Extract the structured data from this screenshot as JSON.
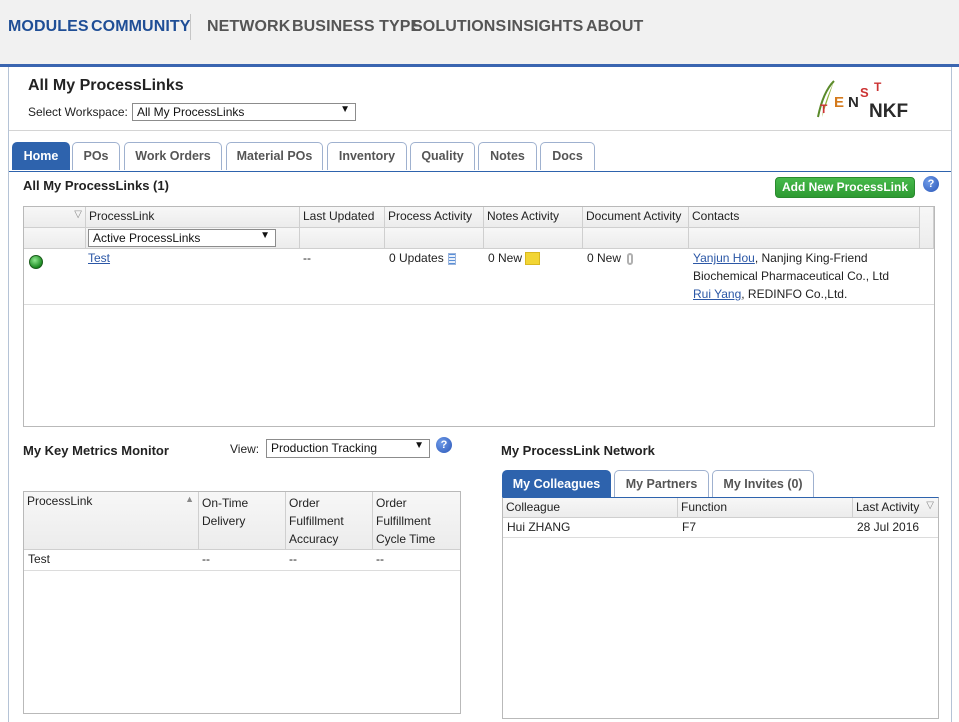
{
  "topnav": {
    "items": [
      "MODULES",
      "COMMUNITY",
      "NETWORK",
      "BUSINESS TYPE",
      "SOLUTIONS",
      "INSIGHTS",
      "ABOUT"
    ]
  },
  "header": {
    "title": "All My ProcessLinks",
    "workspace_label": "Select Workspace:",
    "workspace_value": "All My ProcessLinks",
    "logo_text": "TENSTNKF"
  },
  "tabs": [
    "Home",
    "POs",
    "Work Orders",
    "Material POs",
    "Inventory",
    "Quality",
    "Notes",
    "Docs"
  ],
  "processlinks": {
    "title": "All My ProcessLinks (1)",
    "add_button": "Add New ProcessLink",
    "help": "?",
    "columns": [
      "ProcessLink",
      "Last Updated",
      "Process Activity",
      "Notes Activity",
      "Document Activity",
      "Contacts"
    ],
    "filter_value": "Active ProcessLinks",
    "rows": [
      {
        "name": "Test",
        "last_updated": "--",
        "process_activity": "0 Updates",
        "notes_activity": "0 New",
        "document_activity": "0 New",
        "contact1_name": "Yanjun Hou",
        "contact1_org_line1": ", Nanjing King-Friend",
        "contact1_org_line2": "Biochemical Pharmaceutical Co., Ltd",
        "contact2_name": "Rui Yang",
        "contact2_org": ", REDINFO Co.,Ltd."
      }
    ]
  },
  "metrics": {
    "title": "My Key Metrics Monitor",
    "view_label": "View:",
    "view_value": "Production Tracking",
    "help": "?",
    "columns": {
      "c1": "ProcessLink",
      "c2a": "On-Time",
      "c2b": "Delivery",
      "c3a": "Order",
      "c3b": "Fulfillment",
      "c3c": "Accuracy",
      "c4a": "Order",
      "c4b": "Fulfillment",
      "c4c": "Cycle Time"
    },
    "rows": [
      {
        "name": "Test",
        "v1": "--",
        "v2": "--",
        "v3": "--"
      }
    ]
  },
  "network": {
    "title": "My ProcessLink Network",
    "tabs": [
      "My Colleagues",
      "My Partners",
      "My Invites (0)"
    ],
    "columns": [
      "Colleague",
      "Function",
      "Last Activity"
    ],
    "rows": [
      {
        "colleague": "Hui ZHANG",
        "function": "F7",
        "last_activity": "28 Jul 2016"
      }
    ]
  }
}
